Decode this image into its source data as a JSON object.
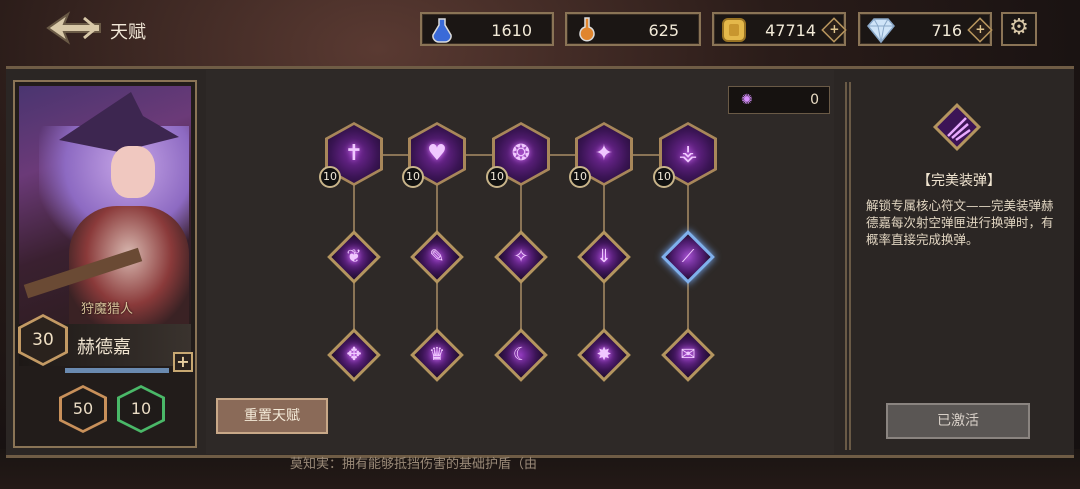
{
  "header": {
    "title": "天赋"
  },
  "resources": [
    {
      "name": "blue-potion",
      "value": "1610",
      "has_plus": false
    },
    {
      "name": "orange-potion",
      "value": "625",
      "has_plus": false
    },
    {
      "name": "gold-coin",
      "value": "47714",
      "has_plus": true
    },
    {
      "name": "diamond",
      "value": "716",
      "has_plus": true
    }
  ],
  "hero": {
    "class_label": "狩魔猎人",
    "name": "赫德嘉",
    "level": "30",
    "stat_a": "50",
    "stat_b": "10",
    "xp_fraction": 0.9
  },
  "talent_tree": {
    "top_row": [
      {
        "glyph": "✝",
        "count": "10"
      },
      {
        "glyph": "♥",
        "count": "10"
      },
      {
        "glyph": "❂",
        "count": "10"
      },
      {
        "glyph": "✦",
        "count": "10"
      },
      {
        "glyph": "⚶",
        "count": "10"
      }
    ],
    "mid_row": [
      {
        "glyph": "❦",
        "selected": false
      },
      {
        "glyph": "✎",
        "selected": false
      },
      {
        "glyph": "✧",
        "selected": false
      },
      {
        "glyph": "⇓",
        "selected": false
      },
      {
        "glyph": "⟋",
        "selected": true
      }
    ],
    "bottom_row": [
      {
        "glyph": "✥",
        "selected": false
      },
      {
        "glyph": "♛",
        "selected": false
      },
      {
        "glyph": "☾",
        "selected": false
      },
      {
        "glyph": "✸",
        "selected": false
      },
      {
        "glyph": "✉",
        "selected": false
      }
    ]
  },
  "rune_counter": {
    "value": "0"
  },
  "detail": {
    "title": "【完美装弹】",
    "description": "解锁专属核心符文——完美装弹赫德嘉每次射空弹匣进行换弹时，有概率直接完成换弹。"
  },
  "buttons": {
    "reset": "重置天赋",
    "activated": "已激活"
  },
  "bottom_text": "莫知実：拥有能够抵挡伤害的基础护盾（由",
  "colors": {
    "accent_gold": "#a8875a",
    "rune_purple": "#7a2aa0",
    "selected_blue": "#7fb0ec"
  }
}
